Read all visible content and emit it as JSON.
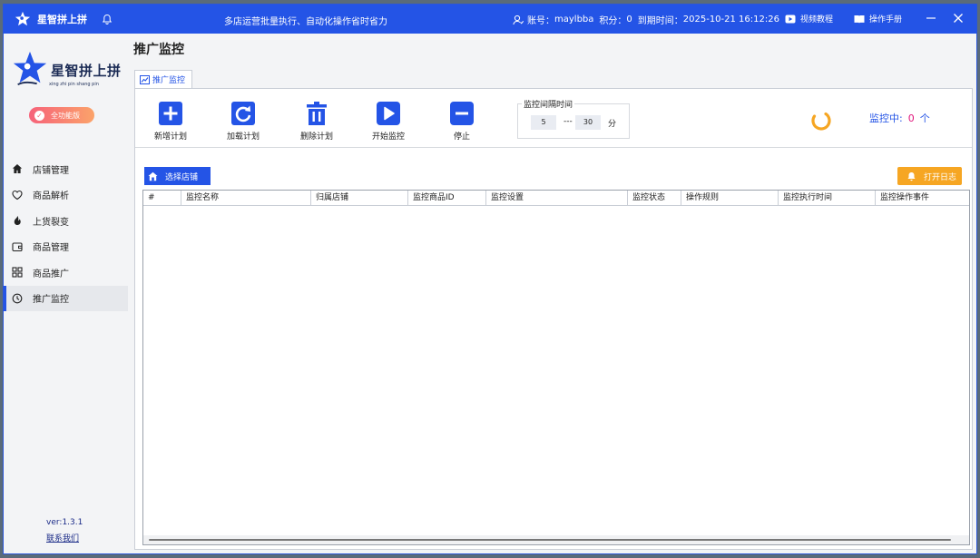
{
  "app": {
    "name": "星智拼上拼",
    "marquee": "多店运营批量执行、自动化操作省时省力、i",
    "account_label": "账号：",
    "account_value": "maylbba",
    "points_label": "积分：",
    "points_value": "0",
    "expiry_label": "到期时间：",
    "expiry_value": "2025-10-21 16:12:26",
    "video_tutorial": "视频教程",
    "manual": "操作手册"
  },
  "sidebar": {
    "logo_text": "星智拼上拼",
    "logo_sub": "xing zhi pin shang pin",
    "badge": "全功能版",
    "items": [
      {
        "label": "店铺管理",
        "icon": "home-icon"
      },
      {
        "label": "商品解析",
        "icon": "heart-icon"
      },
      {
        "label": "上货裂变",
        "icon": "fire-icon"
      },
      {
        "label": "商品管理",
        "icon": "wallet-icon"
      },
      {
        "label": "商品推广",
        "icon": "grid-icon"
      },
      {
        "label": "推广监控",
        "icon": "clock-icon"
      }
    ],
    "version": "ver:1.3.1",
    "contact": "联系我们"
  },
  "page": {
    "title": "推广监控",
    "tab": "推广监控"
  },
  "toolbar": {
    "add_plan": "新增计划",
    "load_plan": "加载计划",
    "delete_plan": "删除计划",
    "start_monitor": "开始监控",
    "stop": "停止",
    "interval_legend": "监控间隔时间",
    "interval_min": "5",
    "interval_sep": "---",
    "interval_max": "30",
    "interval_unit": "分",
    "status_label": "监控中:",
    "status_count": "0",
    "status_unit": "个"
  },
  "actions": {
    "select_store": "选择店铺",
    "open_log": "打开日志"
  },
  "table": {
    "columns": [
      "#",
      "监控名称",
      "归属店铺",
      "监控商品ID",
      "监控设置",
      "监控状态",
      "操作规则",
      "监控执行时间",
      "监控操作事件"
    ]
  },
  "colors": {
    "primary": "#2454e6",
    "accent_orange": "#f6a623",
    "count_pink": "#e0147a"
  }
}
